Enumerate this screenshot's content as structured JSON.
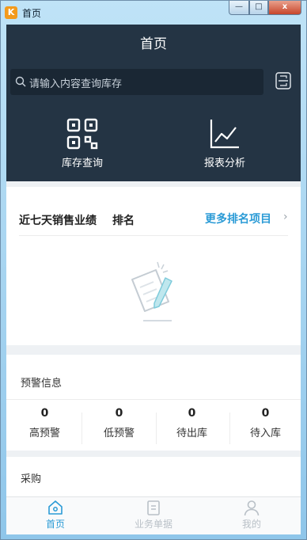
{
  "window": {
    "title": "首页",
    "icon_letter": "K",
    "minimize": "—",
    "maximize": "□",
    "close": "x"
  },
  "header": {
    "title": "首页"
  },
  "search": {
    "placeholder": "请输入内容查询库存"
  },
  "quick_actions": [
    {
      "label": "库存查询",
      "icon": "qr-code-icon"
    },
    {
      "label": "报表分析",
      "icon": "line-chart-icon"
    }
  ],
  "ranking": {
    "title": "近七天销售业绩",
    "tab": "排名",
    "more": "更多排名项目",
    "chevron": "›"
  },
  "alerts": {
    "title": "预警信息",
    "stats": [
      {
        "value": "0",
        "label": "高预警"
      },
      {
        "value": "0",
        "label": "低预警"
      },
      {
        "value": "0",
        "label": "待出库"
      },
      {
        "value": "0",
        "label": "待入库"
      }
    ]
  },
  "purchase": {
    "title": "采购"
  },
  "tabbar": {
    "items": [
      {
        "label": "首页",
        "icon": "home-icon",
        "active": true
      },
      {
        "label": "业务单据",
        "icon": "document-icon",
        "active": false
      },
      {
        "label": "我的",
        "icon": "user-icon",
        "active": false
      }
    ]
  },
  "colors": {
    "header_bg": "#243444",
    "accent": "#2b9bd6",
    "inactive": "#b9c0c7"
  }
}
